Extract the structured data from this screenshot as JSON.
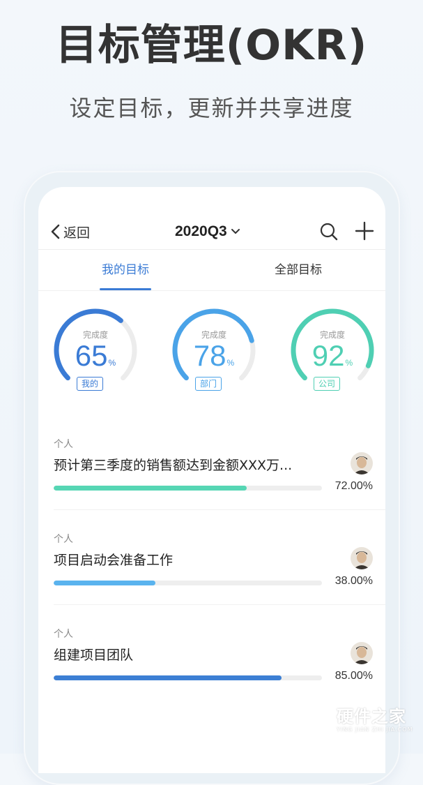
{
  "promo": {
    "title": "目标管理(OKR)",
    "subtitle": "设定目标，更新并共享进度"
  },
  "navbar": {
    "back_label": "返回",
    "period": "2020Q3",
    "icons": [
      "chevron-left-icon",
      "chevron-down-icon",
      "search-icon",
      "plus-icon"
    ]
  },
  "tabs": {
    "my": "我的目标",
    "all": "全部目标",
    "active": "my"
  },
  "gauges": [
    {
      "caption": "完成度",
      "value": "65",
      "unit": "%",
      "tag": "我的",
      "fraction": 0.65,
      "color": "#3a7bd5"
    },
    {
      "caption": "完成度",
      "value": "78",
      "unit": "%",
      "tag": "部门",
      "fraction": 0.78,
      "color": "#4aa3e8"
    },
    {
      "caption": "完成度",
      "value": "92",
      "unit": "%",
      "tag": "公司",
      "fraction": 0.92,
      "color": "#4fcfb3"
    }
  ],
  "goals": [
    {
      "type": "个人",
      "title": "预计第三季度的销售额达到金额XXX万...",
      "progress": 0.72,
      "progress_text": "72.00%",
      "color": "#56d6b4"
    },
    {
      "type": "个人",
      "title": "项目启动会准备工作",
      "progress": 0.38,
      "progress_text": "38.00%",
      "color": "#5ab3ee"
    },
    {
      "type": "个人",
      "title": "组建项目团队",
      "progress": 0.85,
      "progress_text": "85.00%",
      "color": "#3c7fd4"
    }
  ],
  "watermark": {
    "cn": "硬件之家",
    "en": "YING JIAN ZHI JIA.COM"
  },
  "colors": {
    "accent": "#3a7bd5",
    "track": "#eeeeee"
  }
}
